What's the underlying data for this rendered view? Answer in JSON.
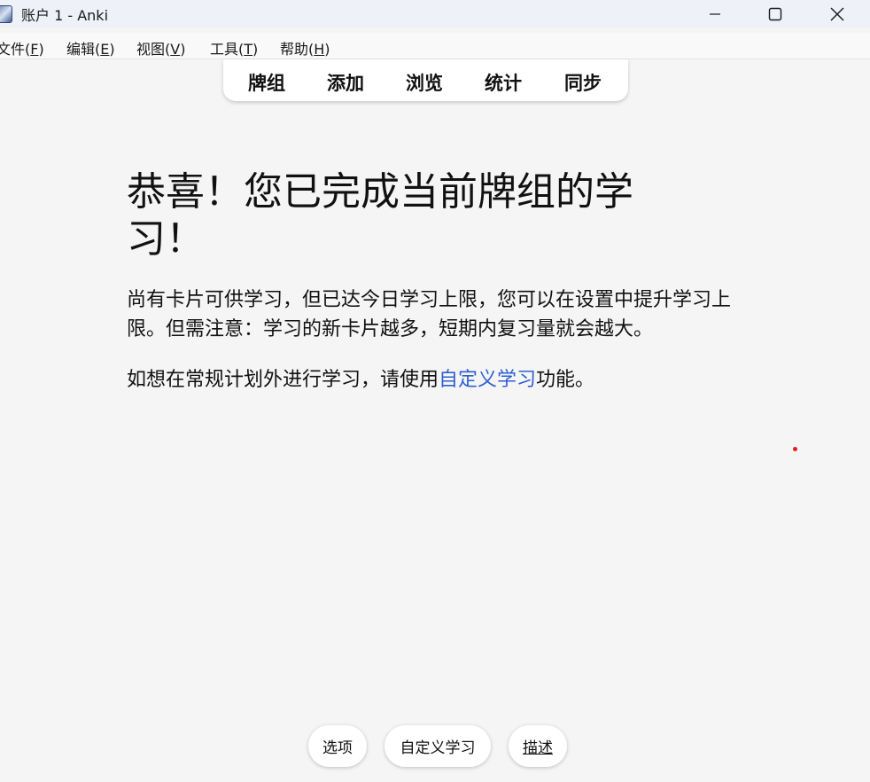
{
  "window": {
    "title": "账户 1 - Anki",
    "app_icon": "anki-icon",
    "controls": {
      "minimize": "minimize-icon",
      "maximize": "maximize-icon",
      "close": "close-icon"
    }
  },
  "menubar": {
    "items": [
      {
        "label": "文件(",
        "key": "F",
        "tail": ")"
      },
      {
        "label": "编辑(",
        "key": "E",
        "tail": ")"
      },
      {
        "label": "视图(",
        "key": "V",
        "tail": ")"
      },
      {
        "label": "工具(",
        "key": "T",
        "tail": ")"
      },
      {
        "label": "帮助(",
        "key": "H",
        "tail": ")"
      }
    ]
  },
  "toolbar": {
    "decks": "牌组",
    "add": "添加",
    "browse": "浏览",
    "stats": "统计",
    "sync": "同步"
  },
  "main": {
    "title": "恭喜！您已完成当前牌组的学习！",
    "paragraph1": "尚有卡片可供学习，但已达今日学习上限，您可以在设置中提升学习上限。但需注意：学习的新卡片越多，短期内复习量就会越大。",
    "paragraph2_before": "如想在常规计划外进行学习，请使用",
    "paragraph2_link": "自定义学习",
    "paragraph2_after": "功能。"
  },
  "bottom_buttons": {
    "options": "选项",
    "custom_study": "自定义学习",
    "describe": "描述"
  },
  "colors": {
    "link": "#2f5fd0",
    "background": "#f5f5f5",
    "titlebar": "#eef1f8",
    "marker_dot": "#e0201b"
  }
}
